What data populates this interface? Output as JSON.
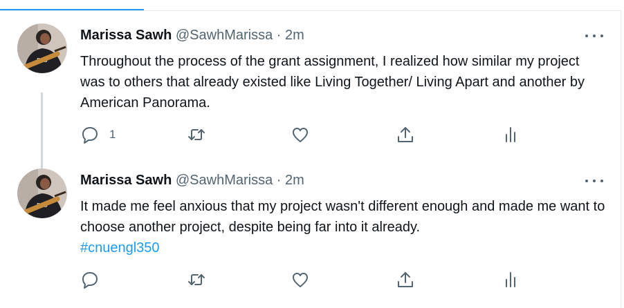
{
  "tweets": [
    {
      "name": "Marissa Sawh",
      "handle": "@SawhMarissa",
      "separator": "·",
      "time": "2m",
      "text": "Throughout the process of the grant assignment, I realized how similar my project was to others that already existed like Living Together/ Living Apart and another by American Panorama.",
      "hashtag": "",
      "reply_count": "1"
    },
    {
      "name": "Marissa Sawh",
      "handle": "@SawhMarissa",
      "separator": "·",
      "time": "2m",
      "text": "It made me feel anxious that my project wasn't different enough and made me want to choose another project, despite being far into it already.",
      "hashtag": "#cnuengl350",
      "reply_count": ""
    }
  ],
  "icons": {
    "reply": "reply-icon",
    "retweet": "retweet-icon",
    "like": "like-icon",
    "share": "share-icon",
    "analytics": "analytics-icon",
    "more": "more-options-icon"
  },
  "colors": {
    "accent": "#1d9bf0",
    "icon": "#536471",
    "text": "#0f1419",
    "thread_line": "#cfd9de"
  }
}
